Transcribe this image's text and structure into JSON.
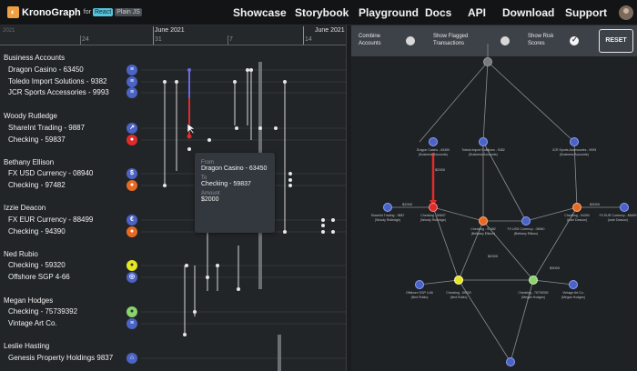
{
  "nav": {
    "brand": "KronoGraph",
    "brand_for": "for",
    "badge_react": "React",
    "badge_plain": "Plain JS",
    "links": [
      "Showcase",
      "Storybook",
      "Playground",
      "Docs",
      "API",
      "Download",
      "Support"
    ]
  },
  "timeline": {
    "year_label": "2021",
    "months": [
      "June 2021",
      "June 2021"
    ],
    "days": [
      "24",
      "31",
      "7",
      "14"
    ],
    "groups": [
      {
        "title": "Business Accounts",
        "accounts": [
          {
            "label": "Dragon Casino - 63450",
            "icon": "bank-icon"
          },
          {
            "label": "Toledo Import Solutions - 9382",
            "icon": "bank-icon"
          },
          {
            "label": "JCR Sports Accessories - 9993",
            "icon": "bank-icon"
          }
        ]
      },
      {
        "title": "Woody Rutledge",
        "accounts": [
          {
            "label": "ShareInt Trading - 9887",
            "icon": "chart-icon"
          },
          {
            "label": "Checking - 59837",
            "icon": "person-icon"
          }
        ]
      },
      {
        "title": "Bethany Ellison",
        "accounts": [
          {
            "label": "FX USD Currency - 08940",
            "icon": "dollar-icon"
          },
          {
            "label": "Checking - 97482",
            "icon": "person-icon"
          }
        ]
      },
      {
        "title": "Izzie Deacon",
        "accounts": [
          {
            "label": "FX EUR Currency - 88499",
            "icon": "euro-icon"
          },
          {
            "label": "Checking - 94390",
            "icon": "person-icon"
          }
        ]
      },
      {
        "title": "Ned Rubio",
        "accounts": [
          {
            "label": "Checking - 59320",
            "icon": "person-icon"
          },
          {
            "label": "Offshore SGP 4-66",
            "icon": "globe-icon"
          }
        ]
      },
      {
        "title": "Megan Hodges",
        "accounts": [
          {
            "label": "Checking - 75739392",
            "icon": "person-icon"
          },
          {
            "label": "Vintage Art Co.",
            "icon": "bank-icon"
          }
        ]
      },
      {
        "title": "Leslie Hasting",
        "accounts": [
          {
            "label": "Genesis Property Holdings 9837",
            "icon": "home-icon"
          }
        ]
      }
    ],
    "tooltip": {
      "from_label": "From",
      "from_value": "Dragon Casino - 63450",
      "to_label": "To",
      "to_value": "Checking - 59837",
      "amount_label": "Amount",
      "amount_value": "$2000"
    }
  },
  "graph": {
    "controls": {
      "combine": "Combine Accounts",
      "flagged": "Show Flagged Transactions",
      "risk": "Show Risk Scores",
      "reset": "RESET"
    },
    "edge_amounts": [
      "$2000",
      "$2000",
      "$2000",
      "$3000",
      "$3000"
    ],
    "nodes": [
      {
        "name": "Dragon Casino - 63450",
        "owner": "(Business Accounts)"
      },
      {
        "name": "Toledo Import Solutions - 9382",
        "owner": "(Business Accounts)"
      },
      {
        "name": "JCR Sports Accessories - 9993",
        "owner": "(Business Accounts)"
      },
      {
        "name": "ShareInt Trading - 9887",
        "owner": "(Woody Rutledge)"
      },
      {
        "name": "Checking - 59837",
        "owner": "(Woody Rutledge)"
      },
      {
        "name": "Checking - 97482",
        "owner": "(Bethany Ellison)"
      },
      {
        "name": "FX USD Currency - 08940",
        "owner": "(Bethany Ellison)"
      },
      {
        "name": "Checking - 94390",
        "owner": "(Izzie Deacon)"
      },
      {
        "name": "FX EUR Currency - 88499",
        "owner": "(Izzie Deacon)"
      },
      {
        "name": "Offshore SGP 4-66",
        "owner": "(Ned Rubio)"
      },
      {
        "name": "Checking - 59320",
        "owner": "(Ned Rubio)"
      },
      {
        "name": "Checking - 75739392",
        "owner": "(Megan Hodges)"
      },
      {
        "name": "Vintage Art Co.",
        "owner": "(Megan Hodges)"
      }
    ]
  }
}
